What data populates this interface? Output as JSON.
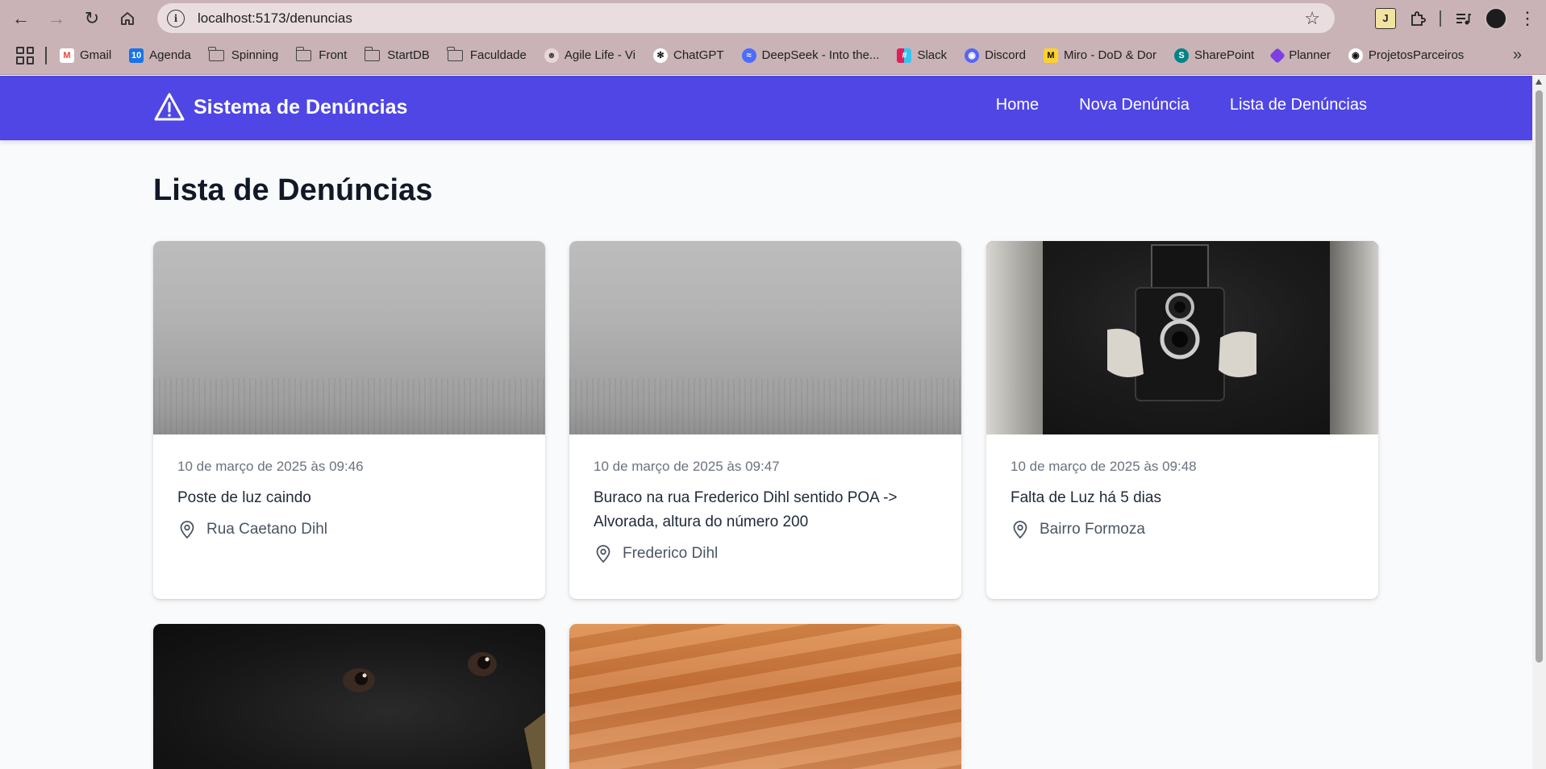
{
  "browser": {
    "url": "localhost:5173/denuncias",
    "bookmarks": [
      {
        "label": "Gmail",
        "icon": "gmail-icon",
        "color": "#ea4335"
      },
      {
        "label": "Agenda",
        "icon": "calendar-icon",
        "color": "#1a73e8"
      },
      {
        "label": "Spinning",
        "icon": "folder-icon"
      },
      {
        "label": "Front",
        "icon": "folder-icon"
      },
      {
        "label": "StartDB",
        "icon": "folder-icon"
      },
      {
        "label": "Faculdade",
        "icon": "folder-icon"
      },
      {
        "label": "Agile Life - Vi",
        "icon": "agile-life-icon"
      },
      {
        "label": "ChatGPT",
        "icon": "chatgpt-icon"
      },
      {
        "label": "DeepSeek - Into the...",
        "icon": "deepseek-icon",
        "color": "#4d6bfe"
      },
      {
        "label": "Slack",
        "icon": "slack-icon"
      },
      {
        "label": "Discord",
        "icon": "discord-icon",
        "color": "#5865f2"
      },
      {
        "label": "Miro - DoD & Dor",
        "icon": "miro-icon",
        "color": "#ffd02f"
      },
      {
        "label": "SharePoint",
        "icon": "sharepoint-icon",
        "color": "#038387"
      },
      {
        "label": "Planner",
        "icon": "planner-icon",
        "color": "#7b3fe4"
      },
      {
        "label": "ProjetosParceiros",
        "icon": "github-icon"
      }
    ]
  },
  "app": {
    "brand": "Sistema de Denúncias",
    "accent": "#4f46e5",
    "nav": {
      "home": "Home",
      "new": "Nova Denúncia",
      "list": "Lista de Denúncias"
    },
    "page_title": "Lista de Denúncias",
    "cards": [
      {
        "date": "10 de março de 2025 às 09:46",
        "title": "Poste de luz caindo",
        "location": "Rua Caetano Dihl"
      },
      {
        "date": "10 de março de 2025 às 09:47",
        "title": "Buraco na rua Frederico Dihl sentido POA -> Alvorada, altura do número 200",
        "location": "Frederico Dihl"
      },
      {
        "date": "10 de março de 2025 às 09:48",
        "title": "Falta de Luz há 5 dias",
        "location": "Bairro Formoza"
      }
    ]
  }
}
